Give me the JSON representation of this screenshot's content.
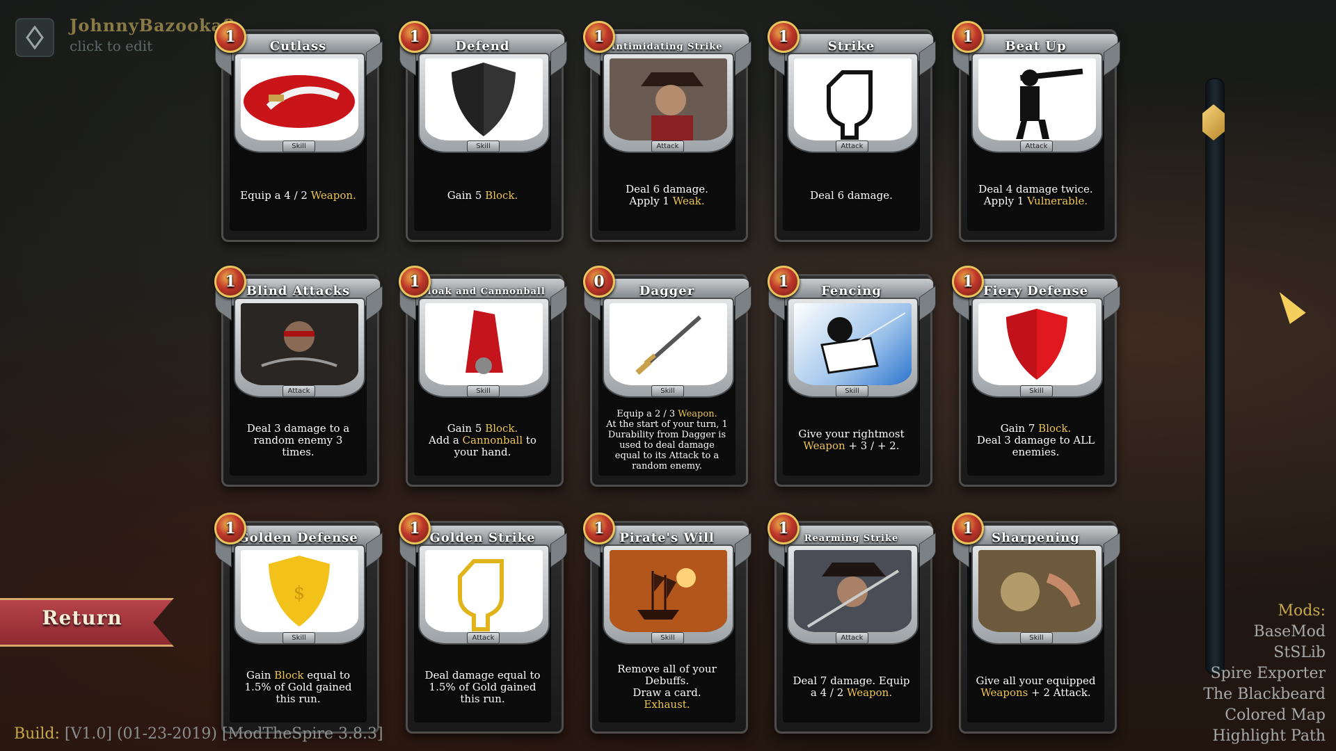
{
  "profile": {
    "name": "JohnnyBazooka8",
    "edit_hint": "click to edit",
    "icon": "diamond-icon"
  },
  "cards": [
    {
      "title": "Cutlass",
      "cost": "1",
      "type": "Skill",
      "art": "cutlass",
      "desc": [
        [
          {
            "t": "Equip a 4 / 2 "
          },
          {
            "t": "Weapon.",
            "k": true
          }
        ]
      ]
    },
    {
      "title": "Defend",
      "cost": "1",
      "type": "Skill",
      "art": "shield-gray",
      "desc": [
        [
          {
            "t": "Gain 5 "
          },
          {
            "t": "Block.",
            "k": true
          }
        ]
      ]
    },
    {
      "title": "Intimidating Strike",
      "cost": "1",
      "type": "Attack",
      "art": "pirate",
      "small": true,
      "desc": [
        [
          {
            "t": "Deal 6 damage."
          }
        ],
        [
          {
            "t": "Apply 1 "
          },
          {
            "t": "Weak.",
            "k": true
          }
        ]
      ]
    },
    {
      "title": "Strike",
      "cost": "1",
      "type": "Attack",
      "art": "fist",
      "desc": [
        [
          {
            "t": "Deal 6 damage."
          }
        ]
      ]
    },
    {
      "title": "Beat Up",
      "cost": "1",
      "type": "Attack",
      "art": "beatup",
      "desc": [
        [
          {
            "t": "Deal 4 damage twice."
          }
        ],
        [
          {
            "t": "Apply 1 "
          },
          {
            "t": "Vulnerable.",
            "k": true
          }
        ]
      ]
    },
    {
      "title": "Blind Attacks",
      "cost": "1",
      "type": "Attack",
      "art": "blind",
      "desc": [
        [
          {
            "t": "Deal 3 damage to a random enemy 3 times."
          }
        ]
      ]
    },
    {
      "title": "Cloak and Cannonball",
      "cost": "1",
      "type": "Skill",
      "art": "cloak",
      "small": true,
      "desc": [
        [
          {
            "t": "Gain 5 "
          },
          {
            "t": "Block.",
            "k": true
          }
        ],
        [
          {
            "t": "Add a "
          },
          {
            "t": "Cannonball",
            "k": true
          },
          {
            "t": " to your hand."
          }
        ]
      ]
    },
    {
      "title": "Dagger",
      "cost": "0",
      "type": "Skill",
      "art": "dagger",
      "tiny": true,
      "desc": [
        [
          {
            "t": "Equip a 2 / 3 "
          },
          {
            "t": "Weapon.",
            "k": true
          }
        ],
        [
          {
            "t": "At the start of your turn, 1 Durability from Dagger is used to deal damage equal to its Attack to a random enemy."
          }
        ]
      ]
    },
    {
      "title": "Fencing",
      "cost": "1",
      "type": "Skill",
      "art": "fencing",
      "desc": [
        [
          {
            "t": "Give your rightmost"
          }
        ],
        [
          {
            "t": "Weapon",
            "k": true
          },
          {
            "t": " + 3 / + 2."
          }
        ]
      ]
    },
    {
      "title": "Fiery Defense",
      "cost": "1",
      "type": "Skill",
      "art": "shield-red",
      "desc": [
        [
          {
            "t": "Gain 7 "
          },
          {
            "t": "Block.",
            "k": true
          }
        ],
        [
          {
            "t": "Deal 3 damage to ALL enemies."
          }
        ]
      ]
    },
    {
      "title": "Golden Defense",
      "cost": "1",
      "type": "Skill",
      "art": "shield-gold",
      "desc": [
        [
          {
            "t": "Gain "
          },
          {
            "t": "Block",
            "k": true
          },
          {
            "t": " equal to 1.5% of Gold gained this run."
          }
        ]
      ]
    },
    {
      "title": "Golden Strike",
      "cost": "1",
      "type": "Attack",
      "art": "fist-gold",
      "desc": [
        [
          {
            "t": "Deal damage equal to 1.5% of Gold gained this run."
          }
        ]
      ]
    },
    {
      "title": "Pirate's Will",
      "cost": "1",
      "type": "Skill",
      "art": "ship",
      "desc": [
        [
          {
            "t": "Remove all of your Debuffs."
          }
        ],
        [
          {
            "t": "Draw a card."
          }
        ],
        [
          {
            "t": "Exhaust.",
            "k": true
          }
        ]
      ]
    },
    {
      "title": "Rearming Strike",
      "cost": "1",
      "type": "Attack",
      "art": "pirate2",
      "small": true,
      "desc": [
        [
          {
            "t": "Deal 7 damage. Equip a 4 / 2 "
          },
          {
            "t": "Weapon.",
            "k": true
          }
        ]
      ]
    },
    {
      "title": "Sharpening",
      "cost": "1",
      "type": "Skill",
      "art": "workshop",
      "desc": [
        [
          {
            "t": "Give all your equipped "
          },
          {
            "t": "Weapons",
            "k": true
          },
          {
            "t": " + 2 Attack."
          }
        ]
      ]
    }
  ],
  "return_button": {
    "label": "Return"
  },
  "build": {
    "key": "Build:",
    "value": "[V1.0] (01-23-2019) [ModTheSpire 3.8.3]"
  },
  "mods": {
    "title": "Mods:",
    "items": [
      "BaseMod",
      "StSLib",
      "Spire Exporter",
      "The Blackbeard",
      "Colored Map",
      "Highlight Path"
    ]
  },
  "colors": {
    "keyword": "#efc851",
    "accent_gold": "#c7a84a",
    "return_red": "#b6434a"
  }
}
